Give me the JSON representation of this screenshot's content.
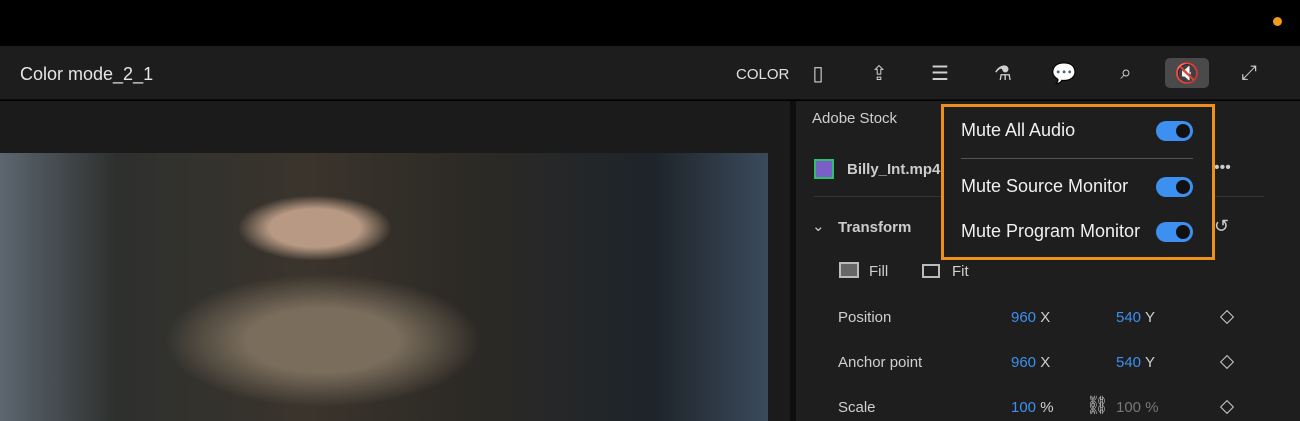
{
  "header": {
    "title": "Color mode_2_1",
    "mode_label": "COLOR",
    "toolbar": [
      {
        "name": "panel-layout-icon",
        "glyph": "▯"
      },
      {
        "name": "share-icon",
        "glyph": "⇪"
      },
      {
        "name": "properties-icon",
        "glyph": "☰"
      },
      {
        "name": "effects-flask-icon",
        "glyph": "⚗"
      },
      {
        "name": "comments-icon",
        "glyph": "💬"
      },
      {
        "name": "search-enhance-icon",
        "glyph": "⌕"
      },
      {
        "name": "mute-audio-icon",
        "glyph": "🔇"
      },
      {
        "name": "fullscreen-icon",
        "glyph": "⤢"
      }
    ]
  },
  "panel": {
    "section": "Adobe Stock",
    "clip": "Billy_Int.mp4",
    "more": "•••",
    "transform": "Transform",
    "fill": "Fill",
    "fit": "Fit",
    "rows": [
      {
        "label": "Position",
        "v1": "960",
        "u1": "X",
        "v2": "540",
        "u2": "Y"
      },
      {
        "label": "Anchor point",
        "v1": "960",
        "u1": "X",
        "v2": "540",
        "u2": "Y"
      },
      {
        "label": "Scale",
        "v1": "100",
        "u1": "%",
        "v2": "100 %",
        "u2": ""
      }
    ]
  },
  "popup": {
    "items": [
      {
        "label": "Mute All Audio",
        "on": true
      },
      {
        "label": "Mute Source Monitor",
        "on": true
      },
      {
        "label": "Mute Program Monitor",
        "on": true
      }
    ]
  }
}
